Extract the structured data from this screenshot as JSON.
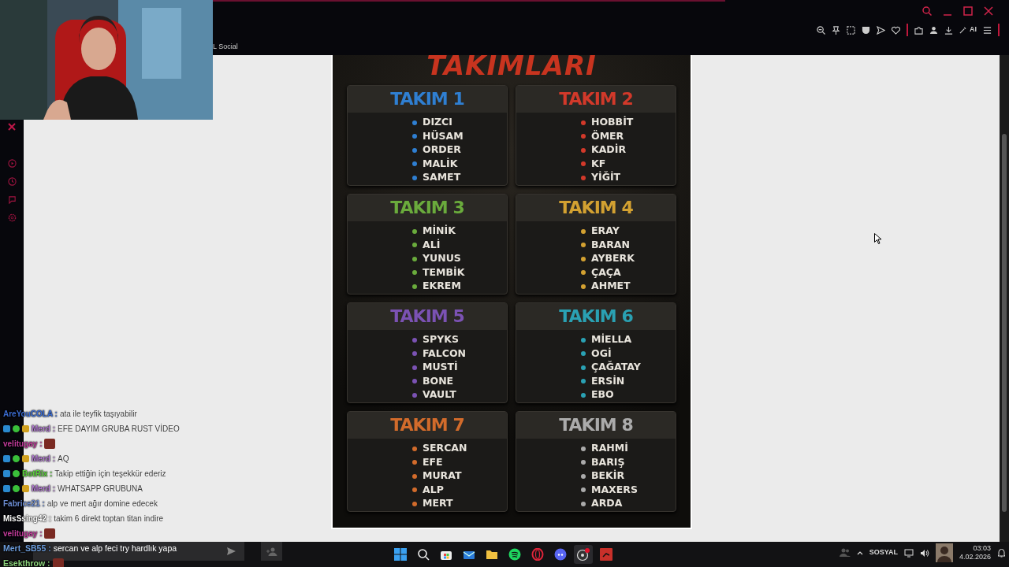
{
  "browser": {
    "tab_label": "L Social",
    "toolbar_ai_label": "AI"
  },
  "poster": {
    "title": "TAKIMLARI",
    "teams": [
      {
        "name": "TAKIM 1",
        "color": "#2f7fd2",
        "members": [
          "DIZCI",
          "HÜSAM",
          "ORDER",
          "MALİK",
          "SAMET"
        ]
      },
      {
        "name": "TAKIM 2",
        "color": "#d2392a",
        "members": [
          "HOBBİT",
          "ÖMER",
          "KADİR",
          "KF",
          "YİĞİT"
        ]
      },
      {
        "name": "TAKIM 3",
        "color": "#6aab3c",
        "members": [
          "MİNİK",
          "ALİ",
          "YUNUS",
          "TEMBİK",
          "EKREM"
        ]
      },
      {
        "name": "TAKIM 4",
        "color": "#d3a131",
        "members": [
          "ERAY",
          "BARAN",
          "AYBERK",
          "ÇAÇA",
          "AHMET"
        ]
      },
      {
        "name": "TAKIM 5",
        "color": "#7b52b3",
        "members": [
          "SPYKS",
          "FALCON",
          "MUSTİ",
          "BONE",
          "VAULT"
        ]
      },
      {
        "name": "TAKIM 6",
        "color": "#2aa1b3",
        "members": [
          "MİELLA",
          "OGİ",
          "ÇAĞATAY",
          "ERSİN",
          "EBO"
        ]
      },
      {
        "name": "TAKIM 7",
        "color": "#d26b2b",
        "members": [
          "SERCAN",
          "EFE",
          "MURAT",
          "ALP",
          "MERT"
        ]
      },
      {
        "name": "TAKIM 8",
        "color": "#ababab",
        "members": [
          "RAHMİ",
          "BARIŞ",
          "BEKİR",
          "MAXERS",
          "ARDA"
        ]
      }
    ]
  },
  "chat": [
    {
      "user": "AreYouCOLA :",
      "color": "#3b6cd2",
      "mod": false,
      "verified": false,
      "sub": false,
      "kind": "text",
      "text": "ata ile teyfik taşıyabilir"
    },
    {
      "user": "Merd :",
      "color": "#b27bd2",
      "mod": true,
      "verified": true,
      "sub": true,
      "kind": "text",
      "text": "EFE DAYIM GRUBA RUST VİDEO"
    },
    {
      "user": "velitugay :",
      "color": "#c23b9b",
      "mod": false,
      "verified": false,
      "sub": false,
      "kind": "emote"
    },
    {
      "user": "Merd :",
      "color": "#b27bd2",
      "mod": true,
      "verified": true,
      "sub": true,
      "kind": "text",
      "text": "AQ"
    },
    {
      "user": "BotRix :",
      "color": "#5bd23b",
      "mod": true,
      "verified": true,
      "sub": false,
      "kind": "text",
      "text": "Takip ettiğin için teşekkür ederiz"
    },
    {
      "user": "Merd :",
      "color": "#b27bd2",
      "mod": true,
      "verified": true,
      "sub": true,
      "kind": "text",
      "text": "WHATSAPP GRUBUNA"
    },
    {
      "user": "Fabrice21 :",
      "color": "#6b8bd2",
      "mod": false,
      "verified": false,
      "sub": false,
      "kind": "text",
      "text": "alp ve mert ağır domine edecek"
    },
    {
      "user": "MisSsing42 :",
      "color": "#ffffff",
      "mod": false,
      "verified": false,
      "sub": false,
      "kind": "text",
      "text": "takim 6 direkt toptan titan indire"
    },
    {
      "user": "velitugay :",
      "color": "#c23b9b",
      "mod": false,
      "verified": false,
      "sub": false,
      "kind": "emote"
    },
    {
      "user": "Mert_SB55 :",
      "color": "#6b9bda",
      "mod": false,
      "verified": false,
      "sub": false,
      "kind": "text",
      "text": "sercan ve alp feci try hardlık yapa"
    },
    {
      "user": "Esekthrow :",
      "color": "#8bd27b",
      "mod": false,
      "verified": false,
      "sub": false,
      "kind": "emote"
    }
  ],
  "taskbar": {
    "tray_label": "SOSYAL",
    "time": "03:03",
    "date": "4.02.2026"
  }
}
